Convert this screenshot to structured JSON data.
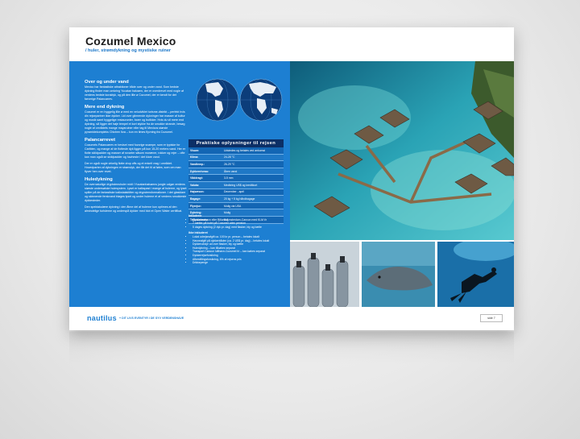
{
  "page": {
    "title": "Cozumel Mexico",
    "subtitle": "/ huler, strømdykning og mystiske ruiner"
  },
  "sections": [
    {
      "heading": "Over og under vand",
      "body": "Mexico har fantastiske attraktioner både over og under vand. Som bedste dykning finder man omkring Yucatan halvøen, der er overdrevet med nogle af verdens bedste koraldyk, og på den lille ø Cozumel, der er kendt for det farverige Palancarrev."
    },
    {
      "heading": "Mere end dykning",
      "body": "Cozumel er en hyggelig lille ø med en veludviklet turisme-distrikt – perfekt hvis din rejsepartner ikke dykker. Lid over glimrende dykninger har masser af kultur og musik samt hyggelige restauranter, barer og butikker. Hvis du vil mere end dykning, så ligger det høje tempel et kort stykke fra de smukke strande, besøg nogle af områdets mange mayaruiner eller tag til Mexicos største pyramidekompleks Chichen Itza – kun en times flyvning fra Cozumel."
    },
    {
      "heading": "Palancarrevet",
      "body": "Cozumels Palancarrev er beviset med fuvorige svampe, som er typiske for Caribien, og mange af de flotteste dyk ligger på kun 15-20 meters vand. Her er flotte skildpadder og masser af rovarter såsom muræner, rokker og rejer – ofte kan man også se skildpadder og havheste i det klare vand.",
      "body2": "Der er også nogle virkelig flotte drop offs og et enkelt vrag i området. Hovedparten af dykningen er strømdyk, der får det til at føles, som om man flyver hen over revet."
    },
    {
      "heading": "Huledykning",
      "body": "De overnaturlige dryptstenshuler midt i Yucatanhalvøens jungle udgør verdens største undersøiske hulesystem. Lyset er kalkspast i mange af hulerne, og lyset spiller på de fantastiske kalkstalaktitter og drypstensformationer. I det glasklare og skinnende ferskvand bløges lyset og under hulerne et af verdens smukkeste dykkesteder.",
      "body2": "Den spektakulære dykning i den åbne del af hulerne kun optimes af den almindelige turisterne og underspå dykker med blot et Open Water certifikat."
    }
  ],
  "facts": {
    "title": "Praktiske oplysninger til rejsen",
    "rows": [
      {
        "k": "Visum:",
        "v": "Udstedes og betales ved ankomst"
      },
      {
        "k": "Klima:",
        "v": "24-28 °C"
      },
      {
        "k": "Vandtemp.:",
        "v": "26-29 °C"
      },
      {
        "k": "Dykkerniveau:",
        "v": "Åben vand"
      },
      {
        "k": "Våddragt:",
        "v": "3-5 mm"
      },
      {
        "k": "Valuta:",
        "v": "Medbring US$ og kreditkort"
      },
      {
        "k": "Højsæson:",
        "v": "December - april"
      },
      {
        "k": "Bagage:",
        "v": "20 kg + 5 kg håndbagage"
      },
      {
        "k": "Flyrejse:",
        "v": "Mulig via USA"
      },
      {
        "k": "Dykning:",
        "v": "Mulig"
      },
      {
        "k": "Tryksammen:",
        "v": "Nej"
      }
    ]
  },
  "includes": {
    "heading": "Inkluderer",
    "items": [
      "Fly København eller Billund-Amsterdam-Cancun med KLM t/r",
      "7 nætter på hotel på Cozumel uden pension",
      "5 dages dykning (2 dyk pr. dag) med flasker, bly og bælte"
    ]
  },
  "extras": {
    "heading": "Ikke inkluderet",
    "items": [
      "Lokal udrejseafgift ca. 100 kr pr. person – betales lokalt",
      "Havneafgift på dykkerbåden (ca. 2 US$ pr. dag) – betales lokalt",
      "Dykkerudstyr ud over flasker, bly og bælte",
      "Huledykning – kan tilkøbes separat",
      "Transport Cancun lufthavn-Cozumel t/r – kan købes separat",
      "Dykkerrejseforsikring",
      "Afbestillingsforsikring, 6% af rejsens pris",
      "Drikkepenge"
    ]
  },
  "footer": {
    "logo": "nautilus",
    "tagline": "+ DIT LIVS EVENTYR I DE SYV VERDENSHAVE",
    "page": "side 7"
  },
  "colors": {
    "accent": "#1d7fd2",
    "dark": "#0c2f66"
  }
}
